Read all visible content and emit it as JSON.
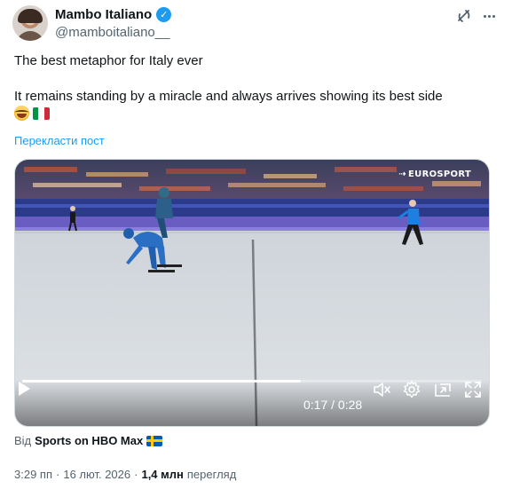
{
  "author": {
    "display_name": "Mambo Italiano",
    "handle": "@mamboitaliano__",
    "verified": true
  },
  "tweet": {
    "line1": "The best metaphor for Italy ever",
    "line2": "It remains standing by a miracle and always arrives showing its best side",
    "emojis": [
      "laughing-with-tears-emoji",
      "italy-flag-emoji"
    ],
    "translate_label": "Перекласти пост"
  },
  "video": {
    "watermark": "EUROSPORT",
    "current_time": "0:17",
    "separator": "/",
    "duration": "0:28",
    "progress_fraction": 0.607
  },
  "source": {
    "prefix": "Від",
    "name": "Sports on HBO Max",
    "flag_icon": "sweden-flag-icon"
  },
  "meta": {
    "time": "3:29 пп",
    "dot1": "·",
    "date": "16 лют. 2026",
    "dot2": "·",
    "views": "1,4 млн",
    "views_label": "перегляд"
  },
  "colors": {
    "accent": "#1d9bf0",
    "text": "#0f1419",
    "secondary": "#536471"
  }
}
